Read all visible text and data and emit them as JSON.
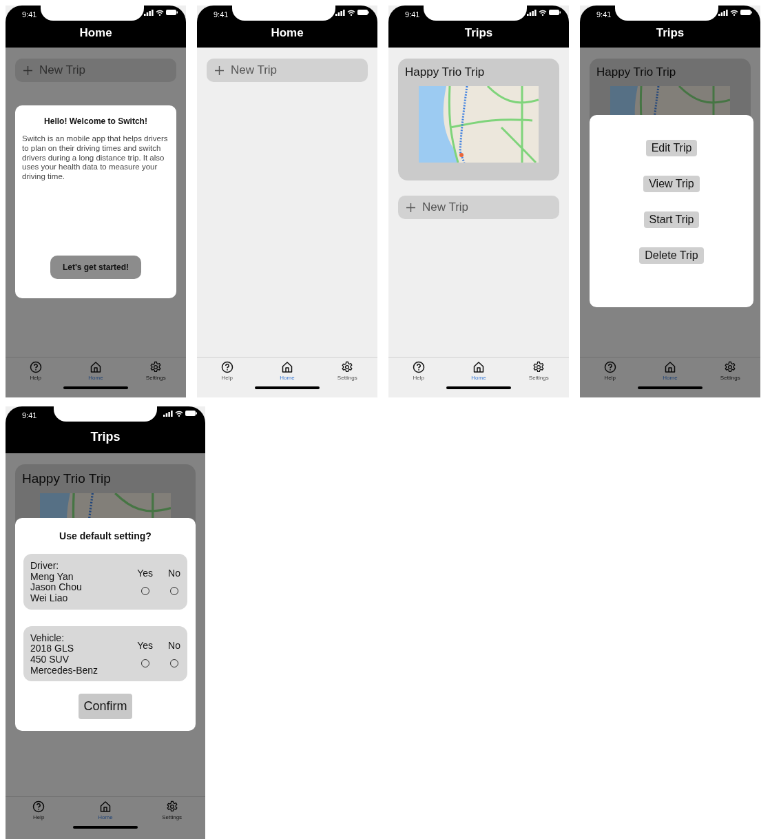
{
  "screens": [
    {
      "status_time": "9:41",
      "title": "Home",
      "dimmed": true,
      "new_trip": "New Trip",
      "modal": {
        "kind": "welcome",
        "title": "Hello! Welcome to Switch!",
        "body": "Switch is an mobile app that helps drivers to plan on their driving times and switch drivers during a long distance trip. It also uses your health data to measure your driving time.",
        "button": "Let's get started!"
      },
      "tabs": [
        {
          "label": "Help",
          "selected": false
        },
        {
          "label": "Home",
          "selected": true
        },
        {
          "label": "Settings",
          "selected": false
        }
      ]
    },
    {
      "status_time": "9:41",
      "title": "Home",
      "dimmed": false,
      "new_trip": "New Trip",
      "tabs": [
        {
          "label": "Help",
          "selected": false
        },
        {
          "label": "Home",
          "selected": true
        },
        {
          "label": "Settings",
          "selected": false
        }
      ]
    },
    {
      "status_time": "9:41",
      "title": "Trips",
      "dimmed": false,
      "trips": [
        {
          "name": "Happy Trio Trip"
        }
      ],
      "new_trip": "New Trip",
      "tabs": [
        {
          "label": "Help",
          "selected": false
        },
        {
          "label": "Home",
          "selected": true
        },
        {
          "label": "Settings",
          "selected": false
        }
      ]
    },
    {
      "status_time": "9:41",
      "title": "Trips",
      "dimmed": true,
      "trips": [
        {
          "name": "Happy Trio Trip"
        }
      ],
      "modal": {
        "kind": "actions",
        "buttons": [
          "Edit Trip",
          "View Trip",
          "Start Trip",
          "Delete Trip"
        ]
      },
      "tabs": [
        {
          "label": "Help",
          "selected": false
        },
        {
          "label": "Home",
          "selected": true
        },
        {
          "label": "Settings",
          "selected": false
        }
      ]
    },
    {
      "status_time": "9:41",
      "title": "Trips",
      "dimmed": true,
      "trips": [
        {
          "name": "Happy Trio Trip"
        }
      ],
      "modal": {
        "kind": "defaults",
        "title": "Use default setting?",
        "groups": [
          {
            "lines": [
              "Driver:",
              "Meng Yan",
              "Jason Chou",
              "Wei Liao"
            ],
            "options": [
              {
                "label": "Yes",
                "selected": false
              },
              {
                "label": "No",
                "selected": false
              }
            ]
          },
          {
            "lines": [
              "Vehicle:",
              "2018 GLS",
              "450 SUV",
              "Mercedes-Benz"
            ],
            "options": [
              {
                "label": "Yes",
                "selected": false
              },
              {
                "label": "No",
                "selected": false
              }
            ]
          }
        ],
        "button": "Confirm"
      },
      "tabs": [
        {
          "label": "Help",
          "selected": false
        },
        {
          "label": "Home",
          "selected": true
        },
        {
          "label": "Settings",
          "selected": false
        }
      ]
    }
  ]
}
